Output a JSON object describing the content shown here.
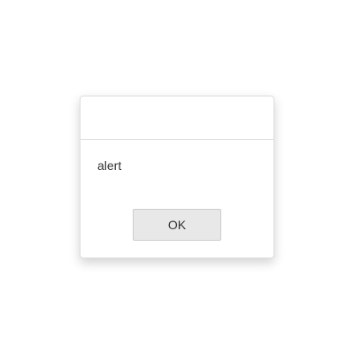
{
  "dialog": {
    "message": "alert",
    "ok_label": "OK"
  }
}
